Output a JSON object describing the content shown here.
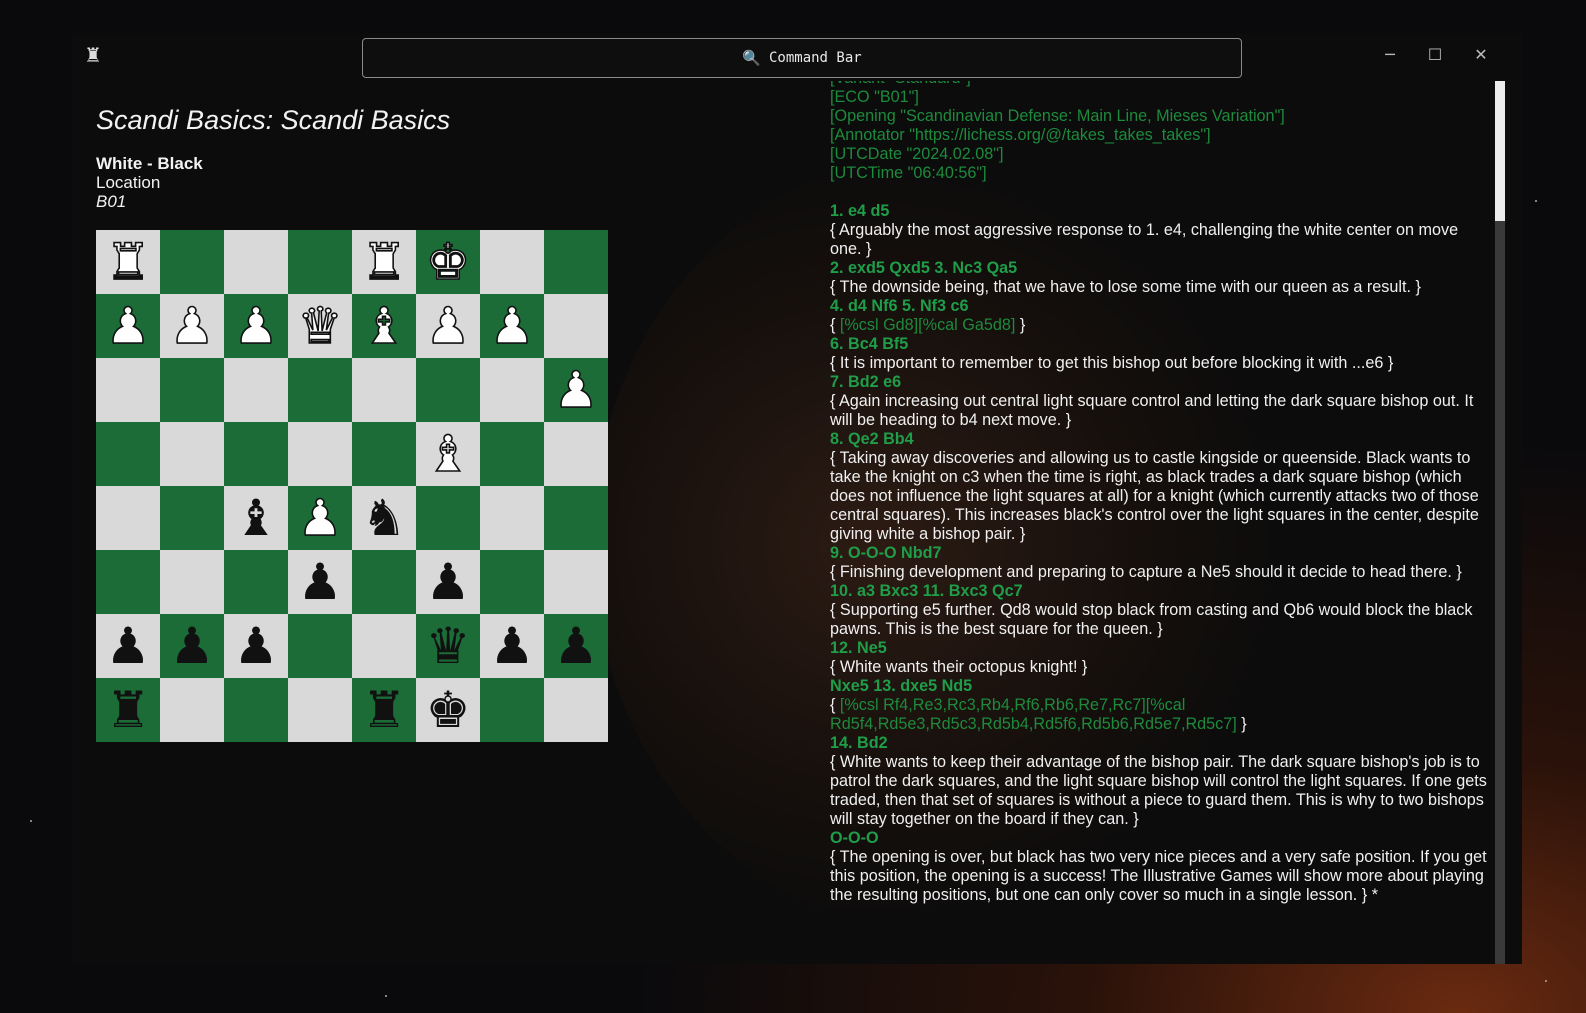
{
  "window": {
    "app_icon": "rook-icon",
    "command_bar": {
      "icon": "search-icon",
      "label": "Command Bar"
    },
    "controls": {
      "minimize": "─",
      "maximize": "☐",
      "close": "✕"
    }
  },
  "game": {
    "title": "Scandi Basics: Scandi Basics",
    "players": "White - Black",
    "location": "Location",
    "eco": "B01"
  },
  "board": {
    "ranks": [
      [
        "wR",
        "",
        "",
        "",
        "wR",
        "wK",
        "",
        ""
      ],
      [
        "wP",
        "wP",
        "wP",
        "wQ",
        "wB",
        "wP",
        "wP",
        ""
      ],
      [
        "",
        "",
        "",
        "",
        "",
        "",
        "",
        "wP"
      ],
      [
        "",
        "",
        "",
        "",
        "",
        "wB",
        "",
        ""
      ],
      [
        "",
        "",
        "bB",
        "wP",
        "bN",
        "",
        "",
        ""
      ],
      [
        "",
        "",
        "",
        "bP",
        "",
        "bP",
        "",
        ""
      ],
      [
        "bP",
        "bP",
        "bP",
        "",
        "",
        "bQ",
        "bP",
        "bP"
      ],
      [
        "bR",
        "",
        "",
        "",
        "bR",
        "bK",
        "",
        ""
      ]
    ]
  },
  "pgn": {
    "headers": [
      "[Variant \"Standard\"]",
      "[ECO \"B01\"]",
      "[Opening \"Scandinavian Defense: Main Line, Mieses Variation\"]",
      "[Annotator \"https://lichess.org/@/takes_takes_takes\"]",
      "[UTCDate \"2024.02.08\"]",
      "[UTCTime \"06:40:56\"]"
    ],
    "moves": [
      {
        "move": "1. e4 d5",
        "comment": "{ Arguably the most aggressive response to 1. e4, challenging the white center on move one. }"
      },
      {
        "move": "2. exd5 Qxd5 3. Nc3 Qa5",
        "comment": "{ The downside being, that we have to lose some time with our queen as a result. }"
      },
      {
        "move": "4. d4 Nf6 5. Nf3 c6",
        "comment_open": "{ ",
        "command": "[%csl Gd8][%cal Ga5d8]",
        "comment_close": " }"
      },
      {
        "move": "6. Bc4 Bf5",
        "comment": "{ It is important to remember to get this bishop out before blocking it with ...e6 }"
      },
      {
        "move": "7. Bd2 e6",
        "comment": "{ Again increasing out central light square control and letting the dark square bishop out. It will be heading to b4 next move. }"
      },
      {
        "move": "8. Qe2 Bb4",
        "comment": "{ Taking away discoveries and allowing us to castle kingside or queenside. Black wants to take the knight on c3 when the time is right, as black trades a dark square bishop (which does not influence the light squares at all) for a knight (which currently attacks two of those central squares). This increases black's control over the light squares in the center, despite giving white a bishop pair. }"
      },
      {
        "move": "9. O-O-O Nbd7",
        "comment": "{ Finishing development and preparing to capture a Ne5 should it decide to head there. }"
      },
      {
        "move": "10. a3 Bxc3 11. Bxc3 Qc7",
        "comment": "{ Supporting e5 further. Qd8 would stop black from casting and Qb6 would block the black pawns. This is the best square for the queen. }"
      },
      {
        "move": "12. Ne5",
        "comment": "{ White wants their octopus knight! }"
      },
      {
        "move": "Nxe5 13. dxe5 Nd5",
        "comment_open": "{ ",
        "command": "[%csl Rf4,Re3,Rc3,Rb4,Rf6,Rb6,Re7,Rc7][%cal Rd5f4,Rd5e3,Rd5c3,Rd5b4,Rd5f6,Rd5b6,Rd5e7,Rd5c7]",
        "comment_close": " }"
      },
      {
        "move": "14. Bd2",
        "comment": "{ White wants to keep their advantage of the bishop pair. The dark square bishop's job is to patrol the dark squares, and the light square bishop will control the light squares. If one gets traded, then that set of squares is without a piece to guard them. This is why to two bishops will stay together on the board if they can. }"
      },
      {
        "move": "O-O-O",
        "comment": "{ The opening is over, but black has two very nice pieces and a very safe position. If you get this position, the opening is a success! The Illustrative Games will show more about playing the resulting positions, but one can only cover so much in a single lesson. } *"
      }
    ]
  },
  "colors": {
    "light_square": "#d9d9d9",
    "dark_square": "#1b6c36",
    "move_text": "#1f9d48",
    "header_text": "#1d8a3c"
  }
}
